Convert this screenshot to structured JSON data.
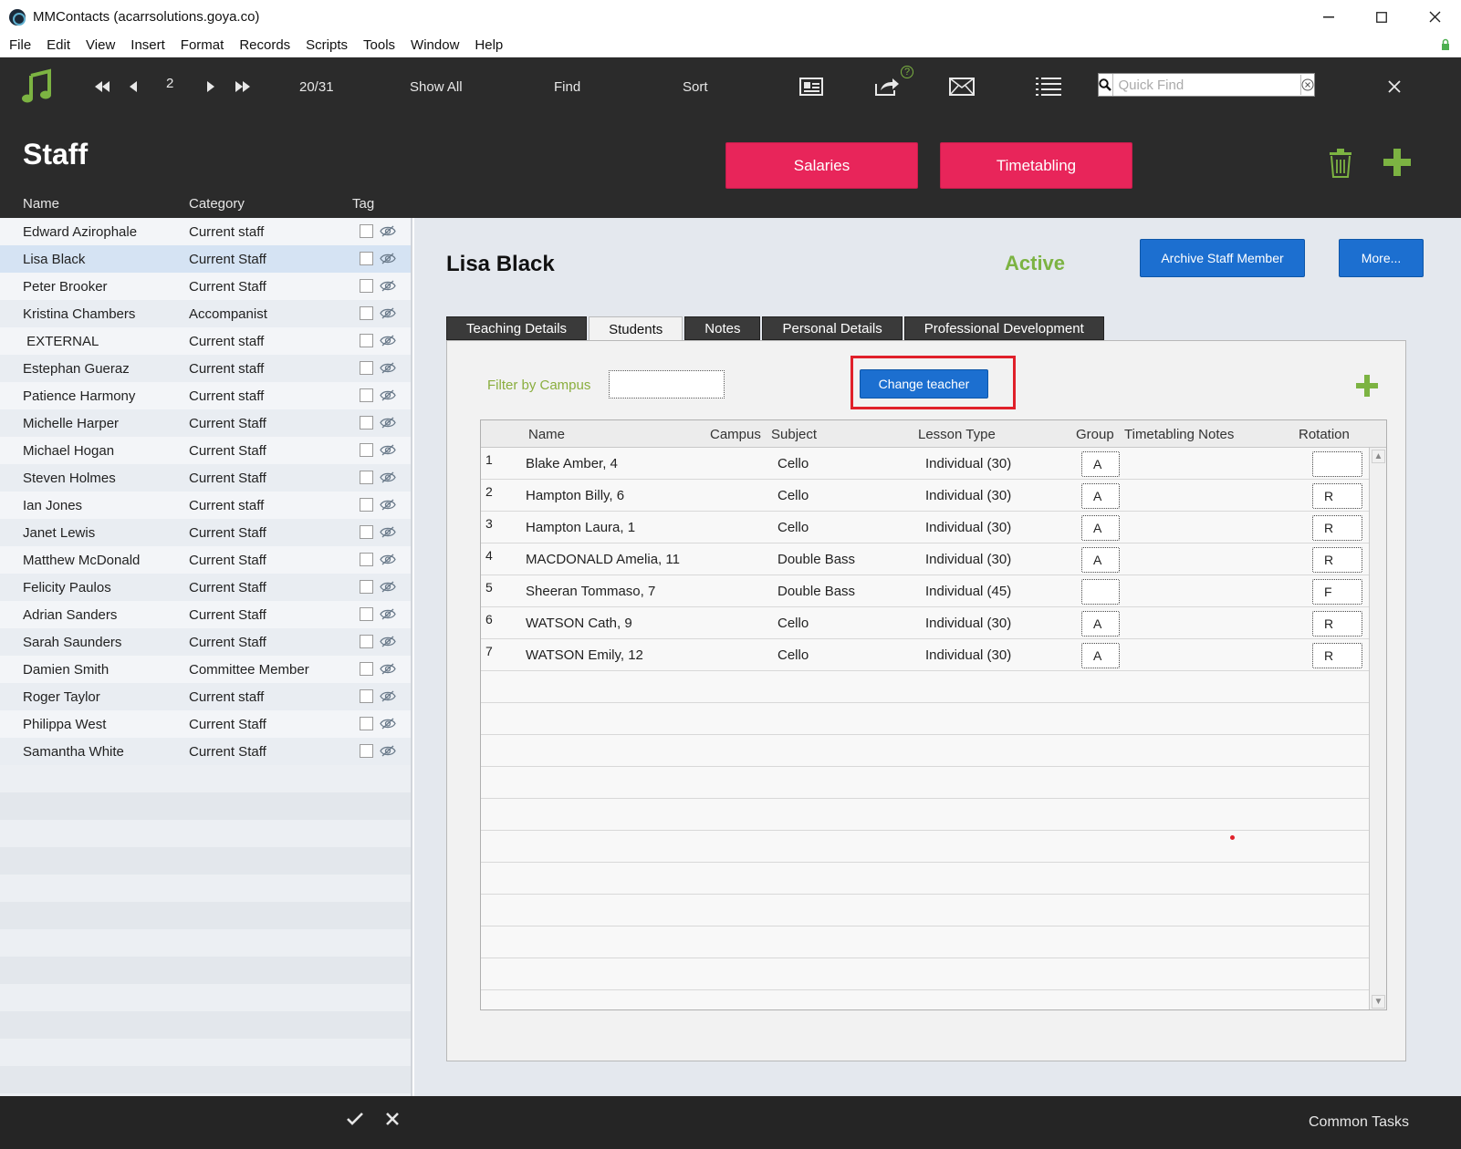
{
  "window": {
    "title": "MMContacts (acarrsolutions.goya.co)",
    "controls": [
      "minimize-icon",
      "maximize-icon",
      "close-icon"
    ]
  },
  "menu": [
    "File",
    "Edit",
    "View",
    "Insert",
    "Format",
    "Records",
    "Scripts",
    "Tools",
    "Window",
    "Help"
  ],
  "toolbar": {
    "record_number": "2",
    "record_count": "20/31",
    "show_all": "Show All",
    "find": "Find",
    "sort": "Sort",
    "help_badge": "?",
    "quickfind_placeholder": "Quick Find"
  },
  "header": {
    "title": "Staff",
    "salaries_label": "Salaries",
    "timetabling_label": "Timetabling",
    "columns": {
      "name": "Name",
      "category": "Category",
      "tag": "Tag"
    }
  },
  "staff": [
    {
      "name": "Edward Azirophale",
      "category": "Current staff"
    },
    {
      "name": "Lisa Black",
      "category": "Current Staff"
    },
    {
      "name": "Peter Brooker",
      "category": "Current Staff"
    },
    {
      "name": "Kristina Chambers",
      "category": "Accompanist"
    },
    {
      "name": " EXTERNAL",
      "category": "Current staff"
    },
    {
      "name": "Estephan Gueraz",
      "category": "Current staff"
    },
    {
      "name": "Patience Harmony",
      "category": "Current staff"
    },
    {
      "name": "Michelle Harper",
      "category": "Current Staff"
    },
    {
      "name": "Michael Hogan",
      "category": "Current Staff"
    },
    {
      "name": "Steven Holmes",
      "category": "Current Staff"
    },
    {
      "name": "Ian Jones",
      "category": "Current staff"
    },
    {
      "name": "Janet Lewis",
      "category": "Current Staff"
    },
    {
      "name": "Matthew McDonald",
      "category": "Current Staff"
    },
    {
      "name": "Felicity Paulos",
      "category": "Current Staff"
    },
    {
      "name": "Adrian Sanders",
      "category": "Current Staff"
    },
    {
      "name": "Sarah Saunders",
      "category": "Current Staff"
    },
    {
      "name": "Damien Smith",
      "category": "Committee Member"
    },
    {
      "name": "Roger Taylor",
      "category": "Current staff"
    },
    {
      "name": "Philippa West",
      "category": "Current Staff"
    },
    {
      "name": "Samantha White",
      "category": "Current Staff"
    }
  ],
  "detail": {
    "name": "Lisa Black",
    "status": "Active",
    "archive_label": "Archive Staff Member",
    "more_label": "More...",
    "tabs": [
      "Teaching Details",
      "Students",
      "Notes",
      "Personal Details",
      "Professional Development"
    ],
    "active_tab": "Students",
    "filter_label": "Filter by Campus",
    "filter_value": "",
    "change_teacher_label": "Change teacher",
    "columns": {
      "name": "Name",
      "campus": "Campus",
      "subject": "Subject",
      "lesson_type": "Lesson Type",
      "group": "Group",
      "notes": "Timetabling Notes",
      "rotation": "Rotation"
    },
    "students": [
      {
        "num": "1",
        "name": "Blake Amber, 4",
        "campus": "",
        "subject": "Cello",
        "lesson_type": "Individual (30)",
        "group": "A",
        "notes": "",
        "rotation": ""
      },
      {
        "num": "2",
        "name": "Hampton Billy, 6",
        "campus": "",
        "subject": "Cello",
        "lesson_type": "Individual (30)",
        "group": "A",
        "notes": "",
        "rotation": "R"
      },
      {
        "num": "3",
        "name": "Hampton Laura, 1",
        "campus": "",
        "subject": "Cello",
        "lesson_type": "Individual (30)",
        "group": "A",
        "notes": "",
        "rotation": "R"
      },
      {
        "num": "4",
        "name": "MACDONALD Amelia, 11",
        "campus": "",
        "subject": "Double Bass",
        "lesson_type": "Individual (30)",
        "group": "A",
        "notes": "",
        "rotation": "R"
      },
      {
        "num": "5",
        "name": "Sheeran Tommaso, 7",
        "campus": "",
        "subject": "Double Bass",
        "lesson_type": "Individual (45)",
        "group": "",
        "notes": "",
        "rotation": "F"
      },
      {
        "num": "6",
        "name": "WATSON Cath, 9",
        "campus": "",
        "subject": "Cello",
        "lesson_type": "Individual (30)",
        "group": "A",
        "notes": "",
        "rotation": "R"
      },
      {
        "num": "7",
        "name": "WATSON Emily, 12",
        "campus": "",
        "subject": "Cello",
        "lesson_type": "Individual (30)",
        "group": "A",
        "notes": "",
        "rotation": "R"
      }
    ]
  },
  "footer": {
    "common_tasks": "Common Tasks"
  },
  "colors": {
    "toolbar_bg": "#2b2b2b",
    "pink_button": "#e8255a",
    "blue_button": "#1c6fd0",
    "active_green": "#7cb342",
    "highlight_red": "#e0202a"
  }
}
